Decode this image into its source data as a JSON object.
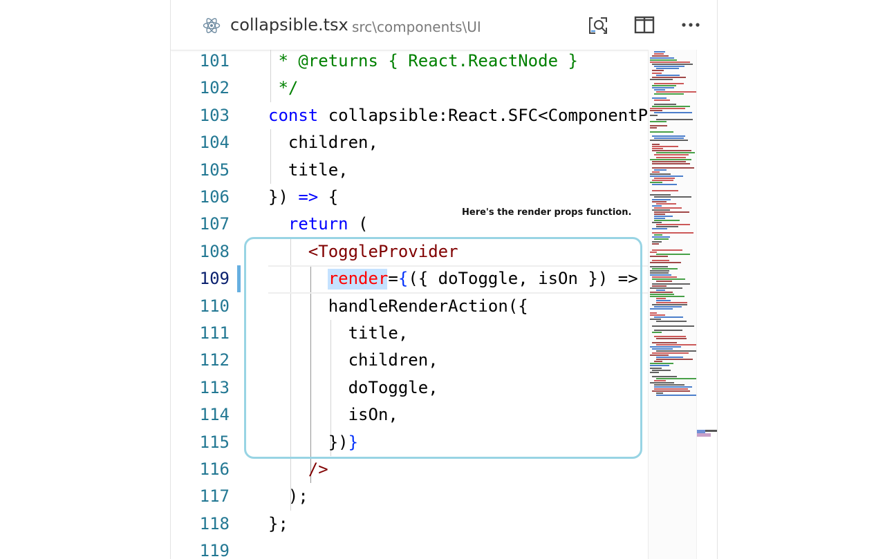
{
  "tab": {
    "filename": "collapsible.tsx",
    "path": "src\\components\\UI",
    "icon": "react-icon",
    "actions": [
      "open-preview-icon",
      "split-editor-icon",
      "more-actions-icon"
    ]
  },
  "annotation": {
    "text": "Here's the render props function."
  },
  "colors": {
    "line_number": "#237893",
    "comment": "#008000",
    "keyword": "#0000ff",
    "tag": "#800000",
    "attribute": "#ff0000",
    "highlight_border": "#98d4e4",
    "react_icon": "#519aba"
  },
  "lines": [
    {
      "number": "101",
      "segments": [
        {
          "text": " * @returns { React.ReactNode }",
          "cls": "t-comment"
        }
      ]
    },
    {
      "number": "102",
      "segments": [
        {
          "text": " */",
          "cls": "t-comment"
        }
      ]
    },
    {
      "number": "103",
      "segments": [
        {
          "text": "const",
          "cls": "t-kw"
        },
        {
          "text": " collapsible:React.SFC<ComponentProps> = ({",
          "cls": "t-punc"
        }
      ]
    },
    {
      "number": "104",
      "segments": [
        {
          "text": "  children,",
          "cls": "t-punc"
        }
      ]
    },
    {
      "number": "105",
      "segments": [
        {
          "text": "  title,",
          "cls": "t-punc"
        }
      ]
    },
    {
      "number": "106",
      "segments": [
        {
          "text": "}) ",
          "cls": "t-punc"
        },
        {
          "text": "=>",
          "cls": "t-kw"
        },
        {
          "text": " {",
          "cls": "t-punc"
        }
      ]
    },
    {
      "number": "107",
      "segments": [
        {
          "text": "  ",
          "cls": "t-punc"
        },
        {
          "text": "return",
          "cls": "t-kw"
        },
        {
          "text": " (",
          "cls": "t-punc"
        }
      ]
    },
    {
      "number": "108",
      "segments": [
        {
          "text": "    <ToggleProvider",
          "cls": "t-tag"
        }
      ]
    },
    {
      "number": "109",
      "segments": [
        {
          "text": "      ",
          "cls": "t-punc"
        },
        {
          "text": "render",
          "cls": "t-attr"
        },
        {
          "text": "=",
          "cls": "t-punc"
        },
        {
          "text": "{",
          "cls": "t-brace-blue"
        },
        {
          "text": "({ doToggle, isOn }) =>",
          "cls": "t-punc"
        }
      ]
    },
    {
      "number": "110",
      "segments": [
        {
          "text": "      handleRenderAction({",
          "cls": "t-punc"
        }
      ]
    },
    {
      "number": "111",
      "segments": [
        {
          "text": "        title,",
          "cls": "t-punc"
        }
      ]
    },
    {
      "number": "112",
      "segments": [
        {
          "text": "        children,",
          "cls": "t-punc"
        }
      ]
    },
    {
      "number": "113",
      "segments": [
        {
          "text": "        doToggle,",
          "cls": "t-punc"
        }
      ]
    },
    {
      "number": "114",
      "segments": [
        {
          "text": "        isOn,",
          "cls": "t-punc"
        }
      ]
    },
    {
      "number": "115",
      "segments": [
        {
          "text": "      })",
          "cls": "t-punc"
        },
        {
          "text": "}",
          "cls": "t-brace-blue"
        }
      ]
    },
    {
      "number": "116",
      "segments": [
        {
          "text": "    />",
          "cls": "t-tag"
        }
      ]
    },
    {
      "number": "117",
      "segments": [
        {
          "text": "  );",
          "cls": "t-punc"
        }
      ]
    },
    {
      "number": "118",
      "segments": [
        {
          "text": "};",
          "cls": "t-punc"
        }
      ]
    },
    {
      "number": "119",
      "segments": [
        {
          "text": "",
          "cls": "t-punc"
        }
      ]
    }
  ]
}
